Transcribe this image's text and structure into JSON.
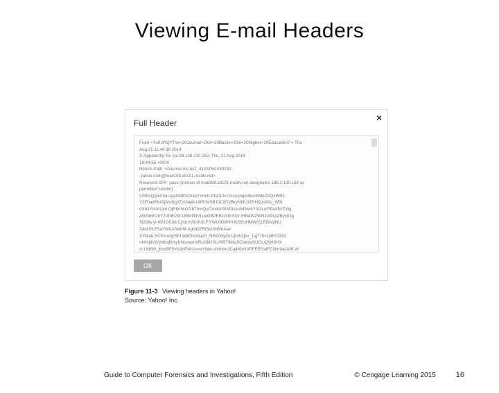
{
  "title": "Viewing E-mail Headers",
  "panel": {
    "title": "Full Header",
    "close": "×",
    "lines": [
      "From =?utf-8?Q?The=20Journal=20of=20Backs=20in=20Higher=20Education? = Thu",
      "Aug 21 11:44:38 2014",
      "X-Apparently-To:                                          via 98.138.210.252; Thu, 21 Aug 2014",
      "18:44:55 +0000",
      "Return-Path: <bounce-mc.us2_4103754.030233",
      "         .yahoo.com@mail158.atl101.mcdlv.net>",
      "Received-SPF: pass (domain of mail158.atl101.mcdlv.net designates 195.2.130.158 as",
      "permitted sender)",
      "vXRIsQgomVa-cyaXbI8SZnJpYzHuIt-PbZXJ=Y3-ucy/epclbocWdeZXQxWR1",
      "Y2F0aW9uOjAiv3qy/ZzVlaj4LU8RJwSB1bCBTyBkyN6bJGf5HQzaGlo_W5r",
      "dXb3YHArUy4:OjRItnNuXSbThmQuiTm4sh3G83sxuInPwt4Y0/3LuFf0aX5I/ZXlg",
      "AWS6IE2hY2VIbE29rJJBbIIfNVLueGBZEBzzUbYXII IHNeWZWNJ0/91dZByc0Jg",
      "SlZldw.yI-rBUOIUIe:CysloY/8UIUlLF.YWIXIDWIfrUkGEoHMW/CLEBAQNU",
      "Z4oU0LE5aYWIUiAWrM-AgNI0ZRlSoUbWIrAair",
      "XYMaILSC5:mx/gISFLWilOlm0IpcP_N5IOWyOLUjh/hZjkv_1qj?7tl=zylECOZd",
      "<k/mjdVjVjintirqRrkyKNsueprmRuGMzSU/ARTIktlvJIClakceSUCLiQWISHX",
      "zI:UN5M_j6oxBF5=N3nFI4rXu=xYWw.uIhInb=2Cq4KbnIVPFEERaIFCNm9asARl.W"
    ],
    "ok": "OK"
  },
  "caption": {
    "label": "Figure 11-3",
    "text": "Viewing headers in Yahoo!"
  },
  "source": "Source: Yahoo! Inc.",
  "footer": {
    "left": "Guide to Computer Forensics and Investigations, Fifth Edition",
    "center": "© Cengage Learning  2015",
    "right": "16"
  }
}
